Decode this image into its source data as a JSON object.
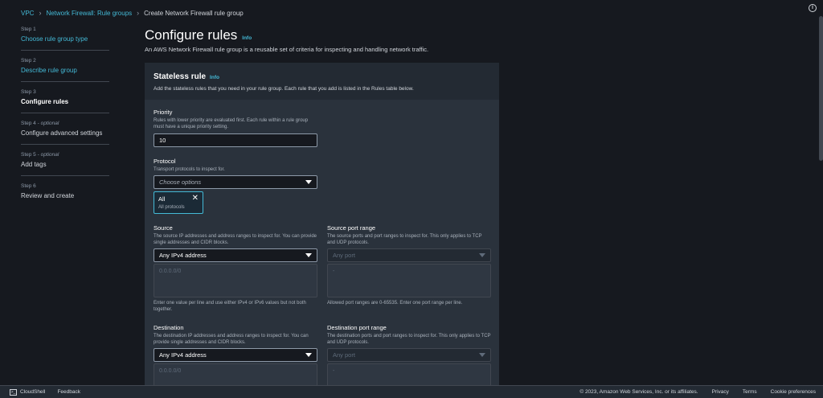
{
  "breadcrumb": {
    "items": [
      "VPC",
      "Network Firewall: Rule groups"
    ],
    "current": "Create Network Firewall rule group"
  },
  "steps": [
    {
      "label": "Step 1",
      "optional": "",
      "title": "Choose rule group type",
      "state": "link"
    },
    {
      "label": "Step 2",
      "optional": "",
      "title": "Describe rule group",
      "state": "link"
    },
    {
      "label": "Step 3",
      "optional": "",
      "title": "Configure rules",
      "state": "current"
    },
    {
      "label": "Step 4 - ",
      "optional": "optional",
      "title": "Configure advanced settings",
      "state": "plain"
    },
    {
      "label": "Step 5 - ",
      "optional": "optional",
      "title": "Add tags",
      "state": "plain"
    },
    {
      "label": "Step 6",
      "optional": "",
      "title": "Review and create",
      "state": "plain"
    }
  ],
  "page": {
    "title": "Configure rules",
    "info": "Info",
    "description": "An AWS Network Firewall rule group is a reusable set of criteria for inspecting and handling network traffic."
  },
  "panel": {
    "title": "Stateless rule",
    "info": "Info",
    "description": "Add the stateless rules that you need in your rule group. Each rule that you add is listed in the Rules table below."
  },
  "priority": {
    "label": "Priority",
    "description": "Rules with lower priority are evaluated first. Each rule within a rule group must have a unique priority setting.",
    "value": "10"
  },
  "protocol": {
    "label": "Protocol",
    "description": "Transport protocols to inspect for.",
    "placeholder": "Choose options",
    "token_value": "All",
    "token_sub": "All protocols"
  },
  "source": {
    "label": "Source",
    "description": "The source IP addresses and address ranges to inspect for. You can provide single addresses and CIDR blocks.",
    "select_value": "Any IPv4 address",
    "textarea_placeholder": "0.0.0.0/0",
    "hint": "Enter one value per line and use either IPv4 or IPv6 values but not both together."
  },
  "source_port": {
    "label": "Source port range",
    "description": "The source ports and port ranges to inspect for. This only applies to TCP and UDP protocols.",
    "select_value": "Any port",
    "textarea_placeholder": "-",
    "hint": "Allowed port ranges are 0-65535. Enter one port range per line."
  },
  "destination": {
    "label": "Destination",
    "description": "The destination IP addresses and address ranges to inspect for. You can provide single addresses and CIDR blocks.",
    "select_value": "Any IPv4 address",
    "textarea_placeholder": "0.0.0.0/0"
  },
  "destination_port": {
    "label": "Destination port range",
    "description": "The destination ports and port ranges to inspect for. This only applies to TCP and UDP protocols.",
    "select_value": "Any port",
    "textarea_placeholder": "-"
  },
  "footer": {
    "cloudshell": "CloudShell",
    "feedback": "Feedback",
    "copyright": "© 2023, Amazon Web Services, Inc. or its affiliates.",
    "privacy": "Privacy",
    "terms": "Terms",
    "cookies": "Cookie preferences"
  }
}
